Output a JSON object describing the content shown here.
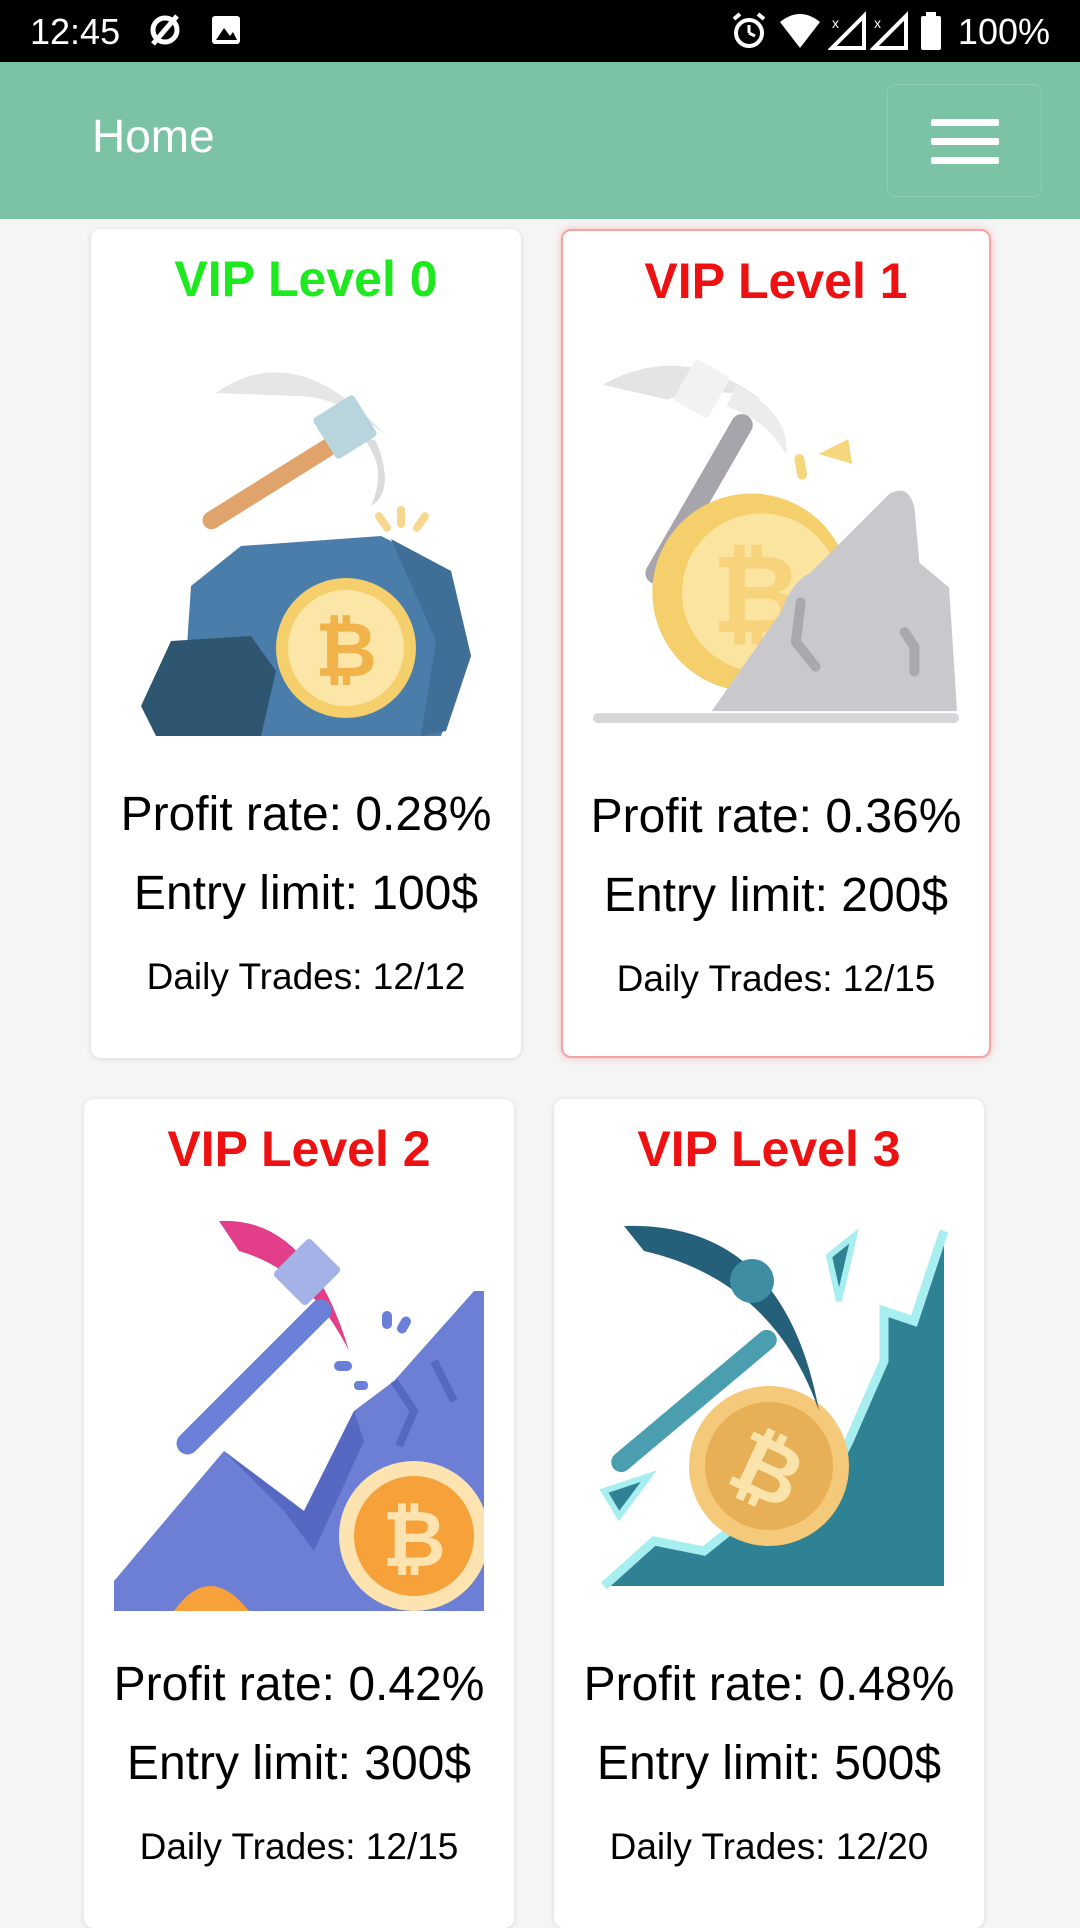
{
  "status_bar": {
    "time": "12:45",
    "battery": "100%",
    "icons": [
      "no-sim-icon",
      "image-icon",
      "alarm-icon",
      "wifi-icon",
      "signal-icon",
      "signal-icon",
      "battery-icon"
    ]
  },
  "app_bar": {
    "title": "Home",
    "menu_icon": "hamburger-menu-icon",
    "color": "#7cc3a5"
  },
  "cards": [
    {
      "title": "VIP Level 0",
      "title_color": "#1ee81e",
      "profit": "Profit rate: 0.28%",
      "entry": "Entry limit: 100$",
      "trades": "Daily Trades: 12/12",
      "selected": false,
      "art": "pickaxe-rock-bitcoin-blue"
    },
    {
      "title": "VIP Level 1",
      "title_color": "#ee1111",
      "profit": "Profit rate: 0.36%",
      "entry": "Entry limit: 200$",
      "trades": "Daily Trades: 12/15",
      "selected": true,
      "art": "pickaxe-rock-bitcoin-grey"
    },
    {
      "title": "VIP Level 2",
      "title_color": "#ee1111",
      "profit": "Profit rate: 0.42%",
      "entry": "Entry limit: 300$",
      "trades": "Daily Trades: 12/15",
      "selected": false,
      "art": "pickaxe-mountain-bitcoin-purple"
    },
    {
      "title": "VIP Level 3",
      "title_color": "#ee1111",
      "profit": "Profit rate: 0.48%",
      "entry": "Entry limit: 500$",
      "trades": "Daily Trades: 12/20",
      "selected": false,
      "art": "pickaxe-cliff-bitcoin-teal"
    }
  ]
}
